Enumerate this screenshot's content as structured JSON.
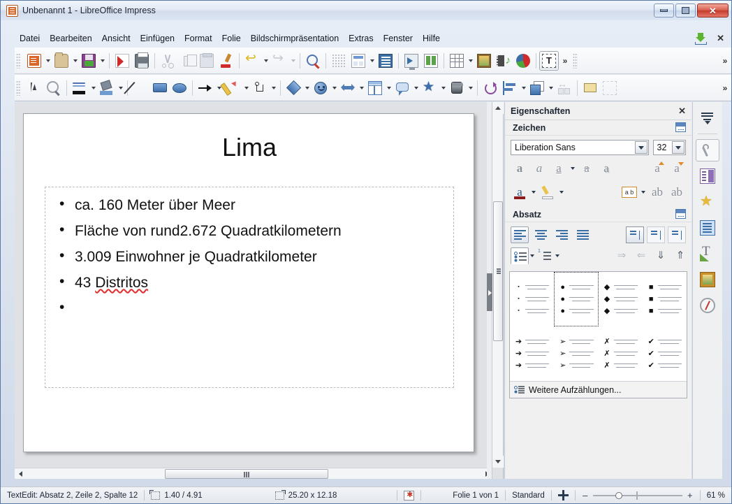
{
  "window": {
    "title": "Unbenannt 1 - LibreOffice Impress",
    "icon": "impress-document-icon",
    "minimize": "–",
    "maximize": "▫",
    "close": "✕"
  },
  "menubar": {
    "items": [
      {
        "label": "Datei"
      },
      {
        "label": "Bearbeiten"
      },
      {
        "label": "Ansicht"
      },
      {
        "label": "Einfügen"
      },
      {
        "label": "Format"
      },
      {
        "label": "Folie"
      },
      {
        "label": "Bildschirmpräsentation"
      },
      {
        "label": "Extras"
      },
      {
        "label": "Fenster"
      },
      {
        "label": "Hilfe"
      }
    ],
    "save_icon": "save-download-icon",
    "close_doc": "✕"
  },
  "toolbar_standard": {
    "overflow": "»",
    "items": [
      {
        "name": "new-document",
        "icon": "new-document-icon",
        "dropdown": true
      },
      {
        "name": "open",
        "icon": "open-folder-icon",
        "dropdown": true
      },
      {
        "name": "save",
        "icon": "save-floppy-icon",
        "dropdown": true
      },
      {
        "name": "export-pdf",
        "icon": "pdf-icon",
        "dropdown": false
      },
      {
        "name": "print",
        "icon": "printer-icon",
        "dropdown": false
      },
      {
        "name": "cut",
        "icon": "scissors-icon",
        "dropdown": false,
        "disabled": true
      },
      {
        "name": "copy",
        "icon": "copy-icon",
        "dropdown": false,
        "disabled": true
      },
      {
        "name": "paste",
        "icon": "clipboard-icon",
        "dropdown": false,
        "disabled": true
      },
      {
        "name": "clone-formatting",
        "icon": "paintbrush-icon",
        "dropdown": false
      },
      {
        "name": "undo",
        "icon": "undo-arrow-icon",
        "dropdown": true
      },
      {
        "name": "redo",
        "icon": "redo-arrow-icon",
        "dropdown": true,
        "disabled": true
      },
      {
        "name": "spelling",
        "icon": "spellcheck-icon",
        "dropdown": false
      },
      {
        "name": "display-grid",
        "icon": "grid-icon",
        "dropdown": false
      },
      {
        "name": "slide-layout",
        "icon": "layout-icon",
        "dropdown": true
      },
      {
        "name": "outline-view",
        "icon": "outline-icon",
        "dropdown": false
      },
      {
        "name": "start-presentation",
        "icon": "presentation-screen-icon",
        "dropdown": false
      },
      {
        "name": "start-from-current",
        "icon": "presentation-current-icon",
        "dropdown": false
      },
      {
        "name": "insert-table",
        "icon": "table-icon",
        "dropdown": true
      },
      {
        "name": "insert-image",
        "icon": "image-icon",
        "dropdown": false
      },
      {
        "name": "insert-media",
        "icon": "media-icon",
        "dropdown": false
      },
      {
        "name": "insert-chart",
        "icon": "pie-chart-icon",
        "dropdown": false
      },
      {
        "name": "insert-text-box",
        "icon": "text-box-icon",
        "dropdown": false,
        "selected": true
      }
    ]
  },
  "toolbar_drawing": {
    "overflow": "»",
    "items": [
      {
        "name": "select",
        "icon": "cursor-arrow-icon",
        "dropdown": false
      },
      {
        "name": "zoom",
        "icon": "magnifier-icon",
        "dropdown": false
      },
      {
        "name": "line-style",
        "icon": "line-style-icon",
        "dropdown": true
      },
      {
        "name": "fill-color",
        "icon": "paint-can-icon",
        "dropdown": true
      },
      {
        "name": "insert-line",
        "icon": "diagonal-line-icon",
        "dropdown": false
      },
      {
        "name": "rectangle",
        "icon": "rectangle-icon",
        "dropdown": false
      },
      {
        "name": "ellipse",
        "icon": "ellipse-icon",
        "dropdown": false
      },
      {
        "name": "line-with-arrow",
        "icon": "arrow-line-icon",
        "dropdown": true
      },
      {
        "name": "curve-freeform",
        "icon": "pencil-icon",
        "dropdown": true
      },
      {
        "name": "connector",
        "icon": "connector-icon",
        "dropdown": true
      },
      {
        "name": "basic-shapes",
        "icon": "diamond-shape-icon",
        "dropdown": true
      },
      {
        "name": "symbol-shapes",
        "icon": "smiley-icon",
        "dropdown": true
      },
      {
        "name": "block-arrows",
        "icon": "block-arrow-icon",
        "dropdown": true
      },
      {
        "name": "flowchart",
        "icon": "flowchart-icon",
        "dropdown": true
      },
      {
        "name": "callouts",
        "icon": "callout-icon",
        "dropdown": true
      },
      {
        "name": "stars",
        "icon": "star-icon",
        "dropdown": true
      },
      {
        "name": "3d-objects",
        "icon": "cube-3d-icon",
        "dropdown": true
      },
      {
        "name": "rotate",
        "icon": "rotate-icon",
        "dropdown": false
      },
      {
        "name": "align-objects",
        "icon": "align-icon",
        "dropdown": true
      },
      {
        "name": "arrange",
        "icon": "arrange-icon",
        "dropdown": true
      },
      {
        "name": "distribute",
        "icon": "distribute-icon",
        "dropdown": false,
        "disabled": true
      },
      {
        "name": "shadow",
        "icon": "shadow-icon",
        "dropdown": false
      },
      {
        "name": "crop",
        "icon": "crop-icon",
        "dropdown": false,
        "disabled": true
      }
    ]
  },
  "slide": {
    "title": "Lima",
    "bullets": [
      {
        "text": "ca. 160 Meter über Meer",
        "misspelled": ""
      },
      {
        "text": "Fläche von rund2.672 Quadratkilometern",
        "misspelled": ""
      },
      {
        "text": "3.009 Einwohner je Quadratkilometer",
        "misspelled": ""
      },
      {
        "text": "43 ",
        "misspelled": "Distritos"
      },
      {
        "text": "",
        "misspelled": ""
      }
    ]
  },
  "sidebar": {
    "title": "Eigenschaften",
    "close_label": "✕",
    "character_panel": {
      "title": "Zeichen",
      "font_name": "Liberation Sans",
      "font_size": "32",
      "buttons": [
        {
          "name": "bold-button",
          "glyph": "a"
        },
        {
          "name": "italic-button",
          "glyph": "a"
        },
        {
          "name": "underline-button",
          "glyph": "a"
        },
        {
          "name": "strikethrough-button",
          "glyph": "a"
        },
        {
          "name": "shadow-button",
          "glyph": "a"
        },
        {
          "name": "increase-font-size-button",
          "glyph": "a"
        },
        {
          "name": "decrease-font-size-button",
          "glyph": "a"
        },
        {
          "name": "font-color-button",
          "glyph": "a"
        },
        {
          "name": "highlighting-color-button",
          "glyph": ""
        },
        {
          "name": "character-spacing-button",
          "glyph": "a b"
        },
        {
          "name": "superscript-button",
          "glyph": "ab"
        },
        {
          "name": "subscript-button",
          "glyph": "ab"
        }
      ]
    },
    "paragraph_panel": {
      "title": "Absatz",
      "align_buttons": [
        {
          "name": "align-left-button",
          "selected": true
        },
        {
          "name": "align-center-button",
          "selected": false
        },
        {
          "name": "align-right-button",
          "selected": false
        },
        {
          "name": "align-justified-button",
          "selected": false
        }
      ],
      "vertical_buttons": [
        {
          "name": "align-top-button",
          "selected": true
        },
        {
          "name": "align-middle-button",
          "selected": false
        },
        {
          "name": "align-bottom-button",
          "selected": false
        }
      ],
      "list_buttons": [
        {
          "name": "unordered-list-button",
          "active": true
        },
        {
          "name": "ordered-list-button",
          "active": false
        }
      ],
      "indent_buttons": [
        {
          "name": "increase-indent-button",
          "glyph": "⇒"
        },
        {
          "name": "decrease-indent-button",
          "glyph": "⇐"
        },
        {
          "name": "move-down-button",
          "glyph": "⇓"
        },
        {
          "name": "move-up-button",
          "glyph": "⇑"
        }
      ]
    },
    "bullet_gallery": {
      "cells": [
        {
          "name": "bullet-small-dot",
          "mark": "▪",
          "selected": false
        },
        {
          "name": "bullet-filled-circle",
          "mark": "●",
          "selected": true
        },
        {
          "name": "bullet-diamond",
          "mark": "◆",
          "selected": false
        },
        {
          "name": "bullet-filled-square",
          "mark": "■",
          "selected": false
        },
        {
          "name": "bullet-solid-arrow",
          "mark": "➔",
          "selected": false
        },
        {
          "name": "bullet-chevron-arrow",
          "mark": "➢",
          "selected": false
        },
        {
          "name": "bullet-cross",
          "mark": "✗",
          "selected": false
        },
        {
          "name": "bullet-checkmark",
          "mark": "✔",
          "selected": false
        }
      ],
      "more_label": "Weitere Aufzählungen..."
    },
    "tabs": [
      {
        "name": "sidebar-settings-menu",
        "icon": "sidebar-menu-icon",
        "selected": false
      },
      {
        "name": "sidebar-tab-properties-settings",
        "icon": "wrench-icon",
        "selected": true
      },
      {
        "name": "sidebar-tab-properties",
        "icon": "properties-icon",
        "selected": false
      },
      {
        "name": "sidebar-tab-gallery",
        "icon": "gallery-star-icon",
        "selected": false
      },
      {
        "name": "sidebar-tab-slide-transition",
        "icon": "slide-transition-icon",
        "selected": false
      },
      {
        "name": "sidebar-tab-styles",
        "icon": "styles-t-icon",
        "selected": false
      },
      {
        "name": "sidebar-tab-master-slides",
        "icon": "master-slides-icon",
        "selected": false
      },
      {
        "name": "sidebar-tab-navigator",
        "icon": "navigator-compass-icon",
        "selected": false
      }
    ]
  },
  "statusbar": {
    "edit_status": "TextEdit: Absatz 2, Zeile 2, Spalte 12",
    "cursor_position": "1.40 / 4.91",
    "object_size": "25.20 x 12.18",
    "modified_icon": "unsaved-changes-icon",
    "slide_counter": "Folie 1 von 1",
    "master_slide": "Standard",
    "fit_icon": "fit-slide-icon",
    "zoom_out": "–",
    "zoom_in": "+",
    "zoom_level": "61 %"
  },
  "scrollbars": {
    "v_up": "▲",
    "v_down": "▼",
    "h_left": "◀",
    "h_right": "▶"
  }
}
